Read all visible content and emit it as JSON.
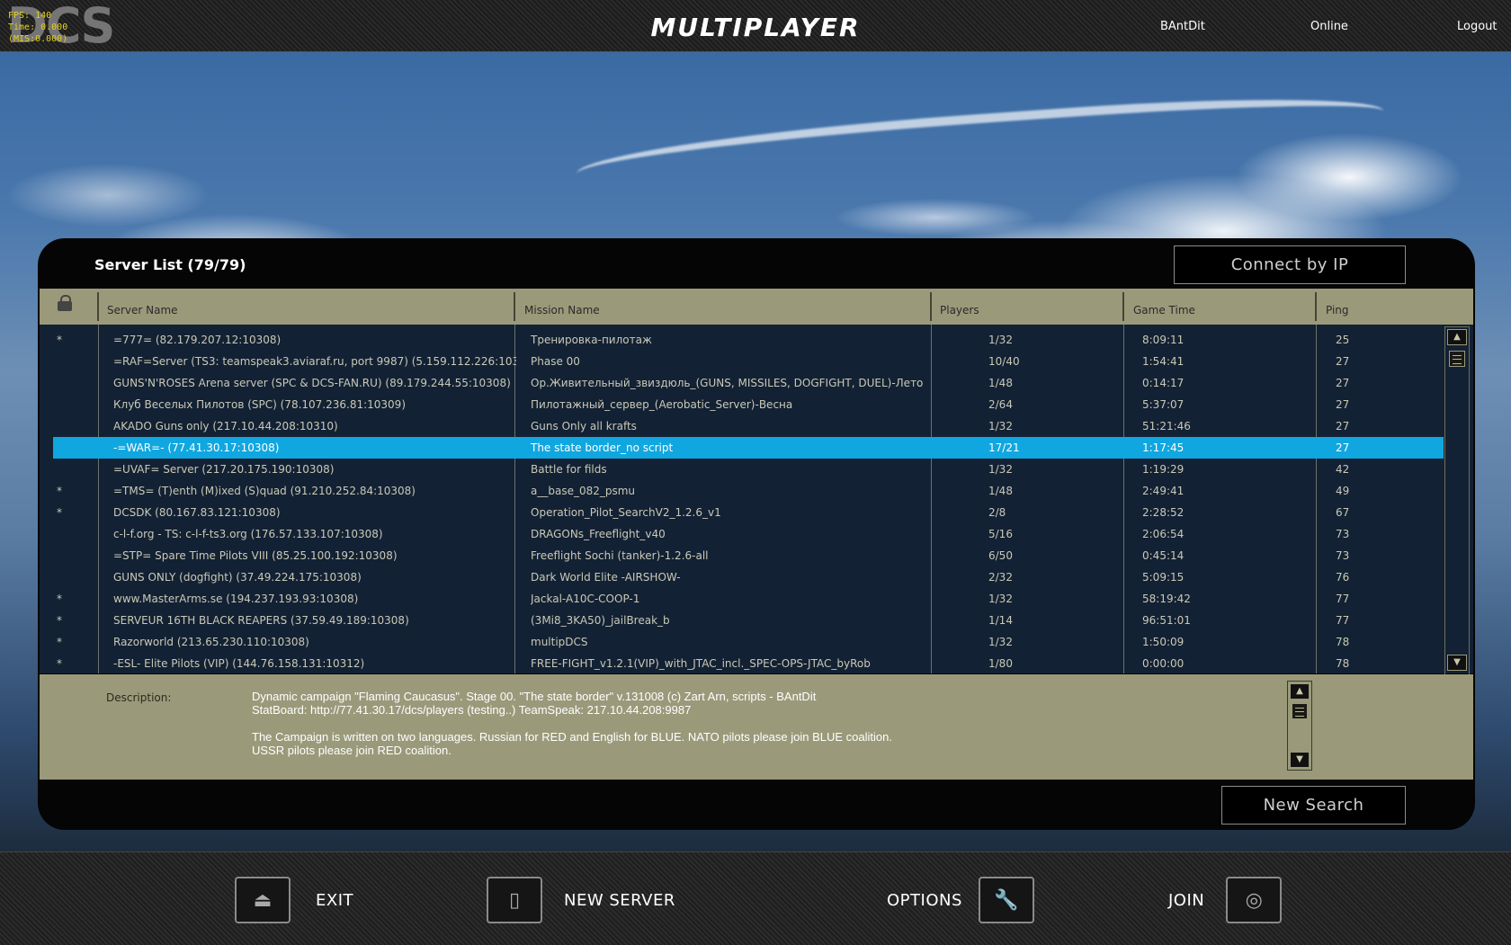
{
  "topbar": {
    "title": "MULTIPLAYER",
    "logo_text": "DCS",
    "fps_lines": [
      "FPS:   140",
      "Time: 0.000",
      "(MIS:0.000)"
    ],
    "user": "BAntDit",
    "status": "Online",
    "logout": "Logout"
  },
  "panel": {
    "title": "Server List (79/79)",
    "connect_label": "Connect by IP",
    "new_search_label": "New Search"
  },
  "columns": {
    "server": "Server Name",
    "mission": "Mission Name",
    "players": "Players",
    "time": "Game Time",
    "ping": "Ping"
  },
  "servers": [
    {
      "star": "*",
      "name": "=777= (82.179.207.12:10308)",
      "mission": "Тренировка-пилотаж",
      "players": "1/32",
      "time": "8:09:11",
      "ping": "25"
    },
    {
      "star": "",
      "name": "=RAF=Server   (TS3: teamspeak3.aviaraf.ru, port 9987) (5.159.112.226:103",
      "mission": "Phase 00",
      "players": "10/40",
      "time": "1:54:41",
      "ping": "27"
    },
    {
      "star": "",
      "name": "GUNS'N'ROSES Arena server (SPC & DCS-FAN.RU) (89.179.244.55:10308)",
      "mission": "Ор.Живительный_звиздюль_(GUNS, MISSILES, DOGFIGHT, DUEL)-Лето",
      "players": "1/48",
      "time": "0:14:17",
      "ping": "27"
    },
    {
      "star": "",
      "name": "Клуб Веселых Пилотов (SPC) (78.107.236.81:10309)",
      "mission": "Пилотажный_сервер_(Aerobatic_Server)-Весна",
      "players": "2/64",
      "time": "5:37:07",
      "ping": "27"
    },
    {
      "star": "",
      "name": "AKADO Guns only (217.10.44.208:10310)",
      "mission": "Guns Only all krafts",
      "players": "1/32",
      "time": "51:21:46",
      "ping": "27"
    },
    {
      "star": "",
      "name": "-=WAR=- (77.41.30.17:10308)",
      "mission": "The state border_no script",
      "players": "17/21",
      "time": "1:17:45",
      "ping": "27",
      "selected": true
    },
    {
      "star": "",
      "name": "=UVAF= Server (217.20.175.190:10308)",
      "mission": "Battle for filds",
      "players": "1/32",
      "time": "1:19:29",
      "ping": "42"
    },
    {
      "star": "*",
      "name": "=TMS= (T)enth (M)ixed (S)quad (91.210.252.84:10308)",
      "mission": "a__base_082_psmu",
      "players": "1/48",
      "time": "2:49:41",
      "ping": "49"
    },
    {
      "star": "*",
      "name": "DCSDK (80.167.83.121:10308)",
      "mission": "Operation_Pilot_SearchV2_1.2.6_v1",
      "players": "2/8",
      "time": "2:28:52",
      "ping": "67"
    },
    {
      "star": "",
      "name": "c-l-f.org - TS: c-l-f-ts3.org (176.57.133.107:10308)",
      "mission": "DRAGONs_Freeflight_v40",
      "players": "5/16",
      "time": "2:06:54",
      "ping": "73"
    },
    {
      "star": "",
      "name": "=STP= Spare Time Pilots VIII (85.25.100.192:10308)",
      "mission": "Freeflight Sochi (tanker)-1.2.6-all",
      "players": "6/50",
      "time": "0:45:14",
      "ping": "73"
    },
    {
      "star": "",
      "name": "GUNS ONLY (dogfight) (37.49.224.175:10308)",
      "mission": "Dark World Elite -AIRSHOW-",
      "players": "2/32",
      "time": "5:09:15",
      "ping": "76"
    },
    {
      "star": "*",
      "name": "www.MasterArms.se (194.237.193.93:10308)",
      "mission": "Jackal-A10C-COOP-1",
      "players": "1/32",
      "time": "58:19:42",
      "ping": "77"
    },
    {
      "star": "*",
      "name": "SERVEUR 16TH BLACK REAPERS (37.59.49.189:10308)",
      "mission": "(3Mi8_3KA50)_jailBreak_b",
      "players": "1/14",
      "time": "96:51:01",
      "ping": "77"
    },
    {
      "star": "*",
      "name": "Razorworld (213.65.230.110:10308)",
      "mission": "multipDCS",
      "players": "1/32",
      "time": "1:50:09",
      "ping": "78"
    },
    {
      "star": "*",
      "name": "-ESL- Elite Pilots (VIP) (144.76.158.131:10312)",
      "mission": "FREE-FIGHT_v1.2.1(VIP)_with_JTAC_incl._SPEC-OPS-JTAC_byRob",
      "players": "1/80",
      "time": "0:00:00",
      "ping": "78"
    }
  ],
  "description": {
    "label": "Description:",
    "text": "Dynamic campaign \"Flaming Caucasus\". Stage 00. \"The state border\" v.131008 (c) Zart Arn, scripts - BAntDit\nStatBoard: http://77.41.30.17/dcs/players (testing..) TeamSpeak: 217.10.44.208:9987\n\nThe Campaign is written on two languages. Russian for RED and English for BLUE. NATO pilots please join BLUE coalition.\nUSSR pilots please join RED coalition."
  },
  "bottom": {
    "exit": "EXIT",
    "new_server": "NEW SERVER",
    "options": "OPTIONS",
    "join": "JOIN"
  }
}
